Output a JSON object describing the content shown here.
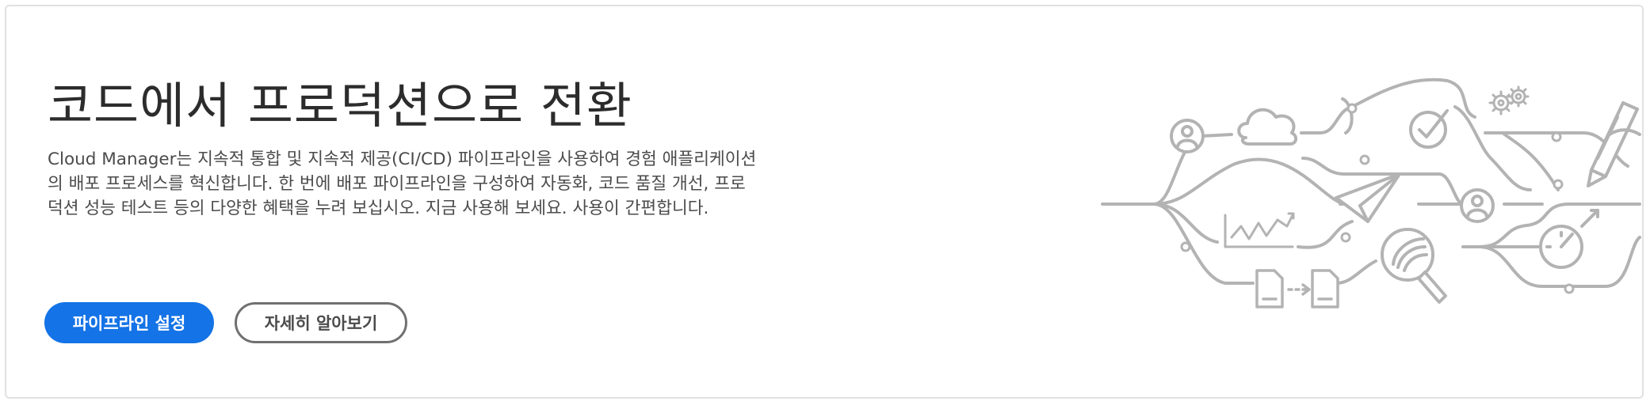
{
  "hero": {
    "title": "코드에서 프로덕션으로 전환",
    "description": "Cloud Manager는 지속적 통합 및 지속적 제공(CI/CD) 파이프라인을 사용하여 경험 애플리케이션의 배포 프로세스를 혁신합니다. 한 번에 배포 파이프라인을 구성하여 자동화, 코드 품질 개선, 프로덕션 성능 테스트 등의 다양한 혜택을 누려 보십시오. 지금 사용해 보세요. 사용이 간편합니다.",
    "primary_button": "파이프라인 설정",
    "secondary_button": "자세히 알아보기"
  },
  "colors": {
    "accent": "#1473e6",
    "illustration_stroke": "#b3b3b3",
    "border": "#e1e1e1"
  },
  "illustration": {
    "icons": [
      "user-icon",
      "cloud-icon",
      "checkmark-icon",
      "gear-icon",
      "pen-icon",
      "paper-plane-icon",
      "chart-icon",
      "magnifier-icon",
      "gauge-icon",
      "document-icon"
    ]
  }
}
